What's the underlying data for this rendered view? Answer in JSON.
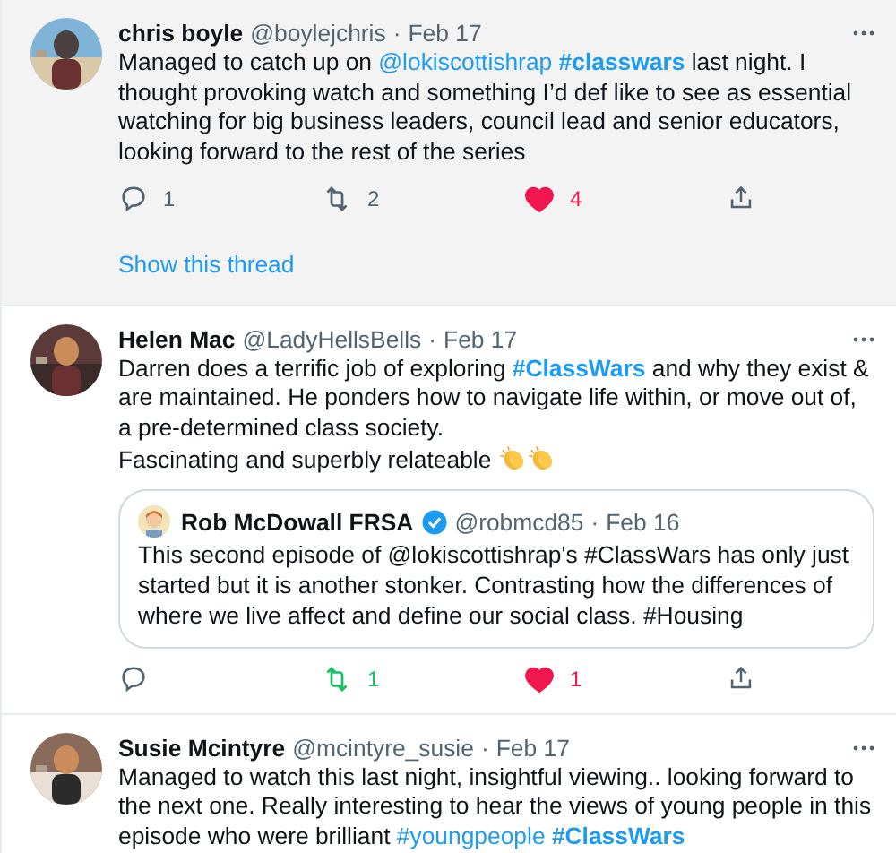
{
  "tweets": [
    {
      "highlighted": true,
      "name": "chris boyle",
      "handle": "@boylejchris",
      "separator": "·",
      "date": "Feb 17",
      "avatar": {
        "kind": "picture"
      },
      "body": [
        {
          "kind": "text",
          "text": "Managed to catch up on "
        },
        {
          "kind": "mention",
          "text": "@lokiscottishrap"
        },
        {
          "kind": "hashtag_bold",
          "text": "#classwars"
        },
        {
          "kind": "text",
          "text": " last night. I thought provoking watch and something I’d def like to see as essential watching for big business leaders, council lead and senior educators, looking forward to the rest of the series"
        }
      ],
      "actions": {
        "replies": "1",
        "retweets": "2",
        "likes": "4",
        "retweeted": false,
        "liked": true
      },
      "thread_link": "Show this thread"
    },
    {
      "highlighted": false,
      "name": "Helen Mac",
      "handle": "@LadyHellsBells",
      "separator": "·",
      "date": "Feb 17",
      "avatar": {
        "kind": "picture"
      },
      "body": [
        {
          "kind": "text",
          "text": "Darren does a terrific job of exploring "
        },
        {
          "kind": "hashtag_bold",
          "text": "#ClassWars"
        },
        {
          "kind": "text",
          "text": " and why they exist & are maintained. He ponders how to navigate life within, or move out of, a pre-determined class society.\nFascinating and superbly relateable "
        },
        {
          "kind": "clap_icon"
        },
        {
          "kind": "clap_icon"
        }
      ],
      "quote": {
        "name": "Rob McDowall FRSA",
        "verified": true,
        "handle": "@robmcd85",
        "separator": "·",
        "date": "Feb 16",
        "text": "This second episode of @lokiscottishrap's #ClassWars has only just started but it is another stonker. Contrasting how the differences of where we live affect and define our social class. #Housing"
      },
      "actions": {
        "retweets": "1",
        "likes": "1",
        "retweeted": true,
        "liked": true
      }
    },
    {
      "highlighted": false,
      "name": "Susie Mcintyre",
      "handle": "@mcintyre_susie",
      "separator": "·",
      "date": "Feb 17",
      "avatar": {
        "kind": "picture"
      },
      "body": [
        {
          "kind": "text",
          "text": "Managed to watch this last night, insightful viewing.. looking forward to the next one. Really interesting to hear the views of young people in this episode who were brilliant "
        },
        {
          "kind": "hashtag",
          "text": "#youngpeople"
        },
        {
          "kind": "hashtag_bold",
          "text": "#ClassWars"
        }
      ]
    }
  ]
}
